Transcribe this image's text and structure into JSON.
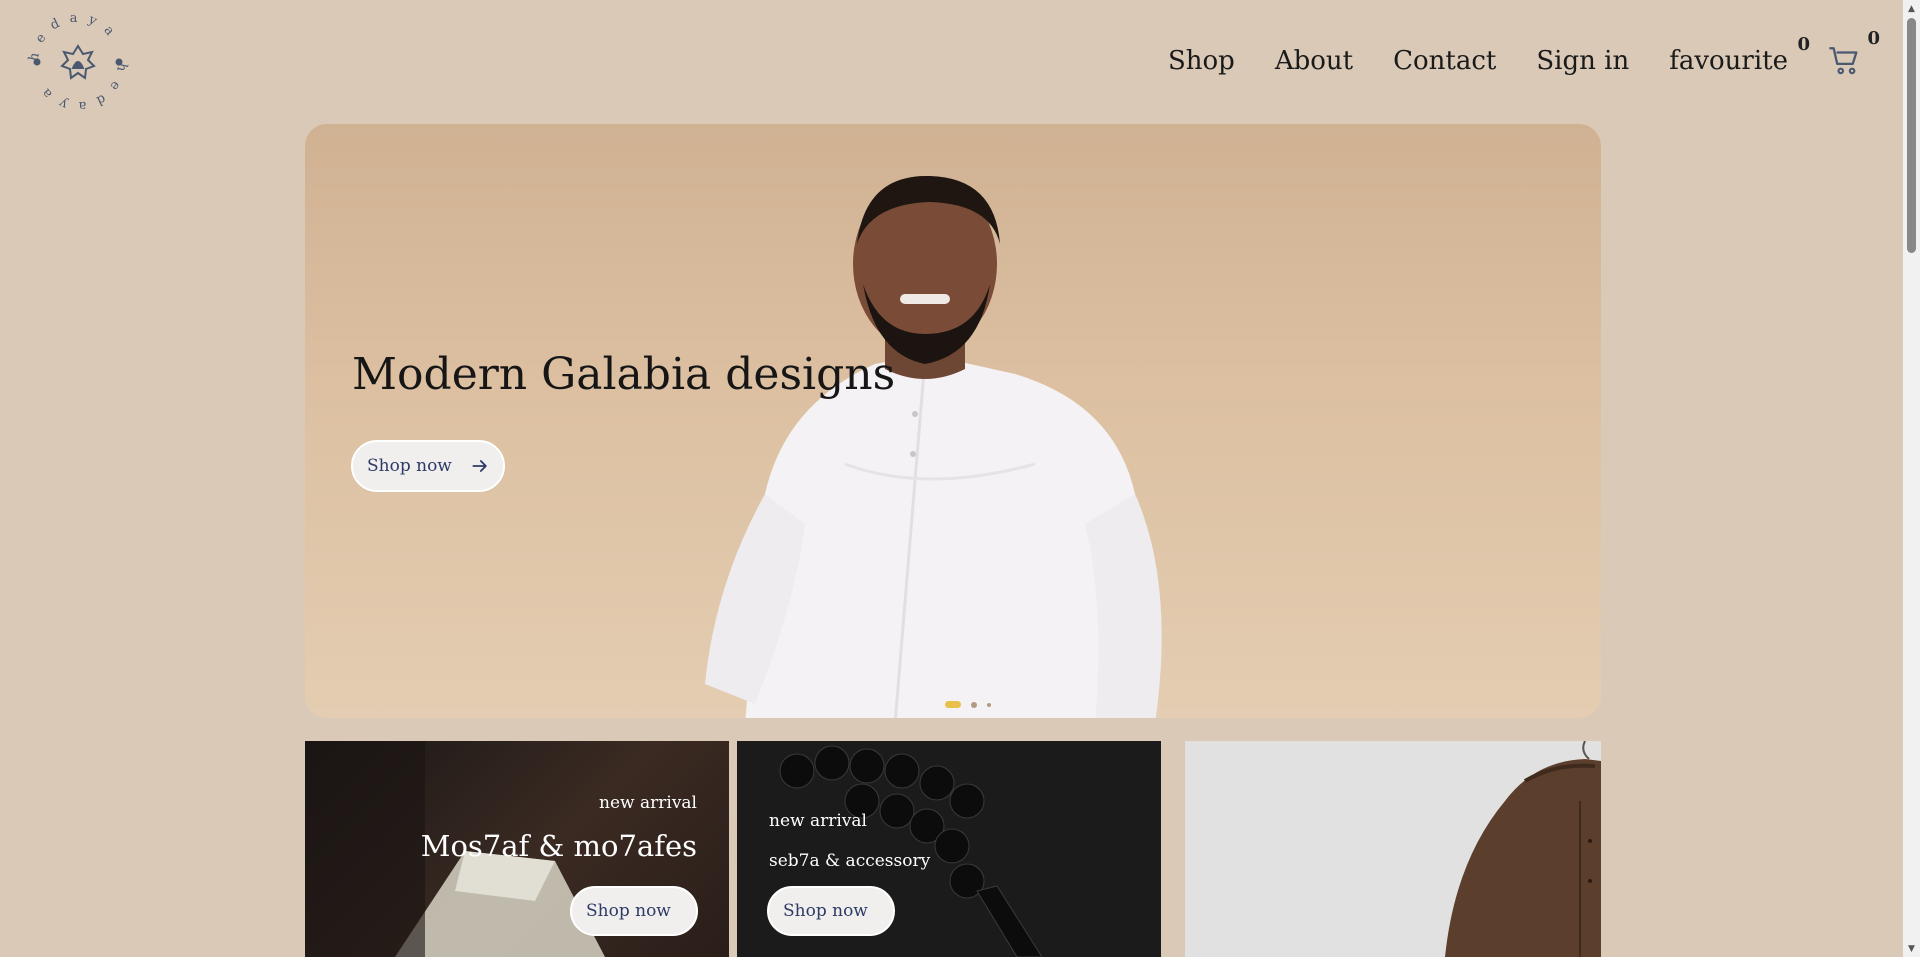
{
  "header": {
    "logo_text": "hedaya",
    "nav": {
      "shop": "Shop",
      "about": "About",
      "contact": "Contact",
      "signin": "Sign in",
      "favourite": "favourite",
      "favourite_count": "0",
      "cart_count": "0"
    },
    "icons": {
      "cart": "cart-icon"
    }
  },
  "hero": {
    "title": "Modern Galabia designs",
    "button_label": "Shop now",
    "slides": 3,
    "active_slide": 1,
    "accent_color": "#e8c04a"
  },
  "cards": [
    {
      "tag": "new arrival",
      "title": "Mos7af & mo7afes",
      "button_label": "Shop now"
    },
    {
      "tag": "new arrival",
      "title": "seb7a & accessory",
      "button_label": "Shop now"
    },
    {
      "tag": "",
      "title": "",
      "button_label": ""
    }
  ],
  "colors": {
    "background": "#d9c9b6",
    "button_text": "#2c3a66"
  }
}
